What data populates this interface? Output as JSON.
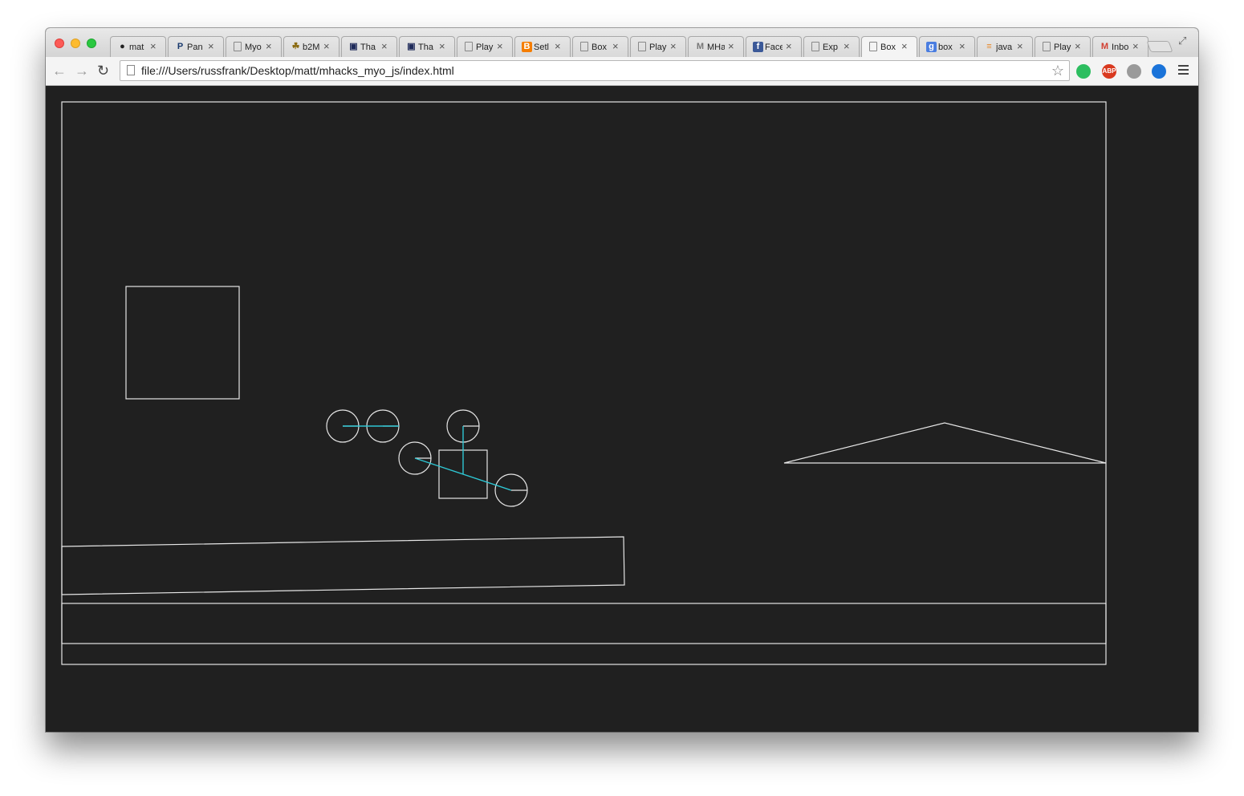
{
  "browser": {
    "tabs": [
      {
        "icon": "github-icon",
        "title": "mat"
      },
      {
        "icon": "pandora-icon",
        "title": "Pan"
      },
      {
        "icon": "document-icon",
        "title": "Myo"
      },
      {
        "icon": "b2m-icon",
        "title": "b2M"
      },
      {
        "icon": "monitor-icon",
        "title": "Tha"
      },
      {
        "icon": "monitor-icon",
        "title": "Tha"
      },
      {
        "icon": "document-icon",
        "title": "Play"
      },
      {
        "icon": "blogger-icon",
        "title": "Setl"
      },
      {
        "icon": "document-icon",
        "title": "Box"
      },
      {
        "icon": "document-icon",
        "title": "Play"
      },
      {
        "icon": "mhacks-icon",
        "title": "MHa"
      },
      {
        "icon": "facebook-icon",
        "title": "Face"
      },
      {
        "icon": "document-icon",
        "title": "Exp"
      },
      {
        "icon": "document-icon",
        "title": "Box",
        "active": true
      },
      {
        "icon": "google-icon",
        "title": "box"
      },
      {
        "icon": "stackoverflow-icon",
        "title": "java"
      },
      {
        "icon": "document-icon",
        "title": "Play"
      },
      {
        "icon": "gmail-icon",
        "title": "Inbo"
      }
    ],
    "tab_close_glyph": "×",
    "url": "file:///Users/russfrank/Desktop/matt/mhacks_myo_js/index.html",
    "back_glyph": "←",
    "forward_glyph": "→",
    "reload_glyph": "↻",
    "star_glyph": "☆",
    "extensions": [
      {
        "name": "evernote-icon",
        "color": "#2dbe60",
        "label": ""
      },
      {
        "name": "adblock-plus-icon",
        "color": "#d9391f",
        "label": "ABP"
      },
      {
        "name": "shield-icon",
        "color": "#9a9a9a",
        "label": ""
      },
      {
        "name": "ghostery-icon",
        "color": "#1a73d9",
        "label": ""
      }
    ]
  },
  "scene": {
    "background": "#202020",
    "stroke": "#e6e6e6",
    "joint_color": "#2ec6d3"
  }
}
